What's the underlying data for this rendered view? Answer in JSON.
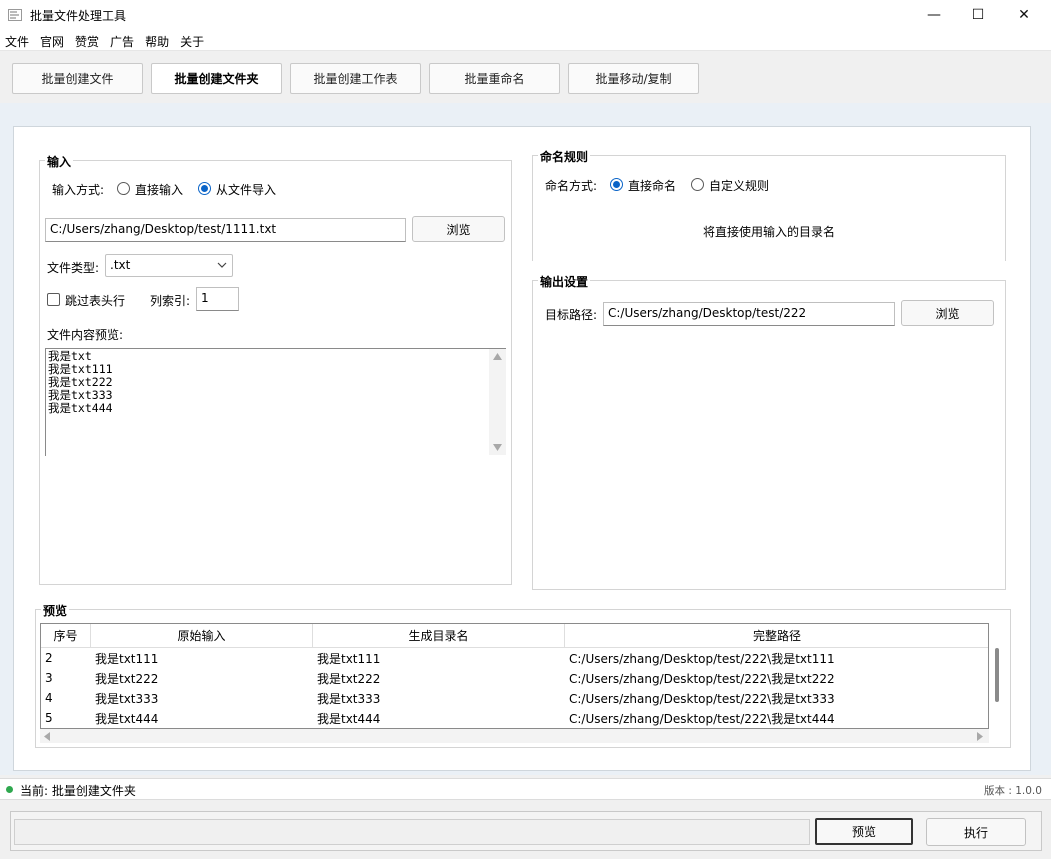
{
  "window": {
    "title": "批量文件处理工具",
    "minimize_glyph": "—",
    "maximize_glyph": "☐",
    "close_glyph": "✕"
  },
  "menu": [
    "文件",
    "官网",
    "赞赏",
    "广告",
    "帮助",
    "关于"
  ],
  "tabs": [
    {
      "label": "批量创建文件",
      "active": false
    },
    {
      "label": "批量创建文件夹",
      "active": true
    },
    {
      "label": "批量创建工作表",
      "active": false
    },
    {
      "label": "批量重命名",
      "active": false
    },
    {
      "label": "批量移动/复制",
      "active": false
    }
  ],
  "input_group": {
    "title": "输入",
    "method_label": "输入方式:",
    "method_options": [
      "直接输入",
      "从文件导入"
    ],
    "method_selected": "从文件导入",
    "file_path": "C:/Users/zhang/Desktop/test/1111.txt",
    "browse_label": "浏览",
    "file_type_label": "文件类型:",
    "file_type_value": ".txt",
    "skip_header_label": "跳过表头行",
    "skip_header_checked": false,
    "column_index_label": "列索引:",
    "column_index_value": "1",
    "preview_label": "文件内容预览:",
    "preview_lines": [
      "我是txt",
      "我是txt111",
      "我是txt222",
      "我是txt333",
      "我是txt444"
    ]
  },
  "naming_group": {
    "title": "命名规则",
    "method_label": "命名方式:",
    "options": [
      "直接命名",
      "自定义规则"
    ],
    "selected": "直接命名",
    "info": "将直接使用输入的目录名"
  },
  "output_group": {
    "title": "输出设置",
    "target_label": "目标路径:",
    "target_path": "C:/Users/zhang/Desktop/test/222",
    "browse_label": "浏览"
  },
  "preview_table": {
    "title": "预览",
    "columns": [
      "序号",
      "原始输入",
      "生成目录名",
      "完整路径"
    ],
    "rows": [
      [
        "2",
        "我是txt111",
        "我是txt111",
        "C:/Users/zhang/Desktop/test/222\\我是txt111"
      ],
      [
        "3",
        "我是txt222",
        "我是txt222",
        "C:/Users/zhang/Desktop/test/222\\我是txt222"
      ],
      [
        "4",
        "我是txt333",
        "我是txt333",
        "C:/Users/zhang/Desktop/test/222\\我是txt333"
      ],
      [
        "5",
        "我是txt444",
        "我是txt444",
        "C:/Users/zhang/Desktop/test/222\\我是txt444"
      ]
    ]
  },
  "status": {
    "current": "当前: 批量创建文件夹",
    "version": "版本 : 1.0.0",
    "indicator_color": "#2fa84f"
  },
  "actions": {
    "preview_label": "预览",
    "execute_label": "执行"
  }
}
